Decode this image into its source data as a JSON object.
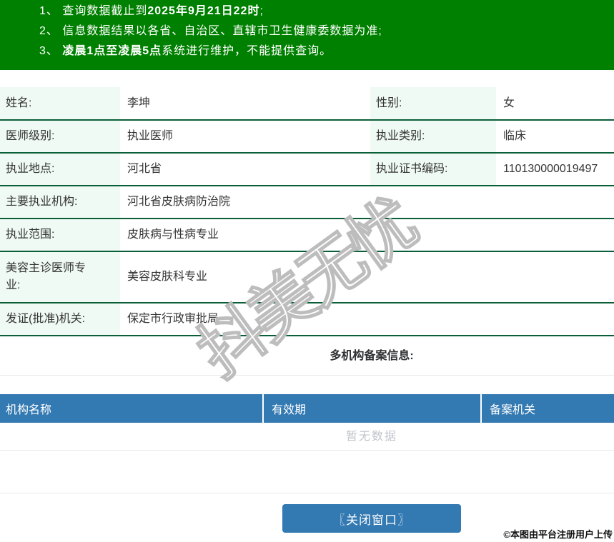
{
  "colors": {
    "banner_green": "#008000",
    "table_border_green": "#0b5f38",
    "label_bg_mint": "#effaf4",
    "header_blue": "#3379b2",
    "button_blue": "#3379b2",
    "empty_text_gray": "#c0c4cc",
    "text_dark": "#333333"
  },
  "notice_banner": {
    "items": [
      {
        "pre": "1、 查询数据截止到",
        "bold": "2025年9月21日22时",
        "post": ";"
      },
      {
        "pre": "2、 信息数据结果以各省、自治区、直辖市卫生健康委数据为准;",
        "bold": "",
        "post": ""
      },
      {
        "pre": "3、 ",
        "bold": "凌晨1点至凌晨5点",
        "post": "系统进行维护，不能提供查询。"
      }
    ]
  },
  "info": {
    "row1": {
      "label1": "姓名:",
      "value1": "李坤",
      "label2": "性别:",
      "value2": "女"
    },
    "row2": {
      "label1": "医师级别:",
      "value1": "执业医师",
      "label2": "执业类别:",
      "value2": "临床"
    },
    "row3": {
      "label1": "执业地点:",
      "value1": "河北省",
      "label2": "执业证书编码:",
      "value2": "110130000019497"
    },
    "row4": {
      "label": "主要执业机构:",
      "value": "河北省皮肤病防治院"
    },
    "row5": {
      "label": "执业范围:",
      "value": "皮肤病与性病专业"
    },
    "row6": {
      "label": "美容主诊医师专业:",
      "value": "美容皮肤科专业"
    },
    "row7": {
      "label": "发证(批准)机关:",
      "value": "保定市行政审批局"
    }
  },
  "records": {
    "title": "多机构备案信息:",
    "columns": [
      "机构名称",
      "有效期",
      "备案机关"
    ],
    "empty_text": "暂无数据"
  },
  "footer": {
    "close_button": "〖关闭窗口〗",
    "upload_note": "©本图由平台注册用户上传"
  },
  "watermark": "抖美无忧"
}
